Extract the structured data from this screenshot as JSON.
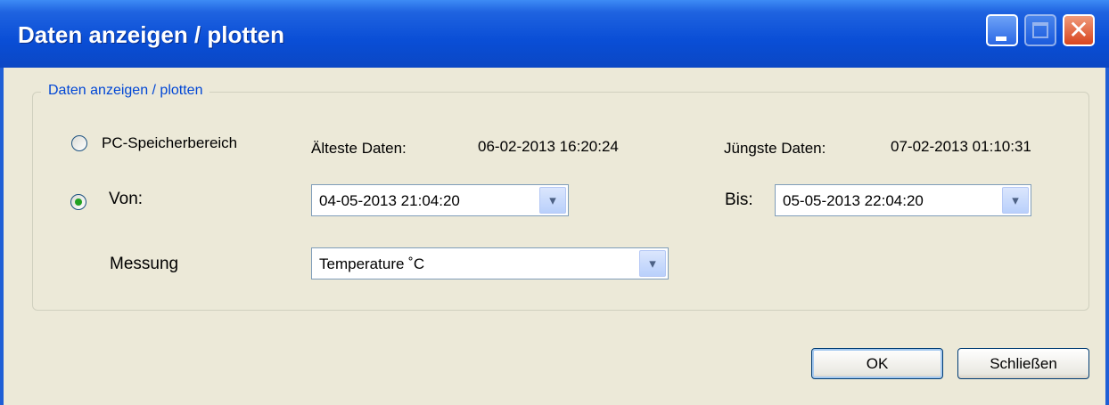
{
  "window": {
    "title": "Daten anzeigen / plotten"
  },
  "group": {
    "caption": "Daten anzeigen / plotten"
  },
  "options": {
    "pc_memory_label": "PC-Speicherbereich",
    "pc_memory_selected": false,
    "from_label": "Von:",
    "from_selected": true,
    "oldest_label": "Älteste Daten:",
    "oldest_value": "06-02-2013 16:20:24",
    "newest_label": "Jüngste Daten:",
    "newest_value": "07-02-2013 01:10:31",
    "from_value": "04-05-2013 21:04:20",
    "to_label": "Bis:",
    "to_value": "05-05-2013 22:04:20",
    "measurement_label": "Messung",
    "measurement_value": "Temperature ˚C"
  },
  "buttons": {
    "ok_label": "OK",
    "close_label": "Schließen"
  },
  "colors": {
    "titlebar": "#0a4ed6",
    "client_bg": "#ece9d8",
    "group_caption": "#0046d5",
    "radio_dot": "#21a121"
  }
}
